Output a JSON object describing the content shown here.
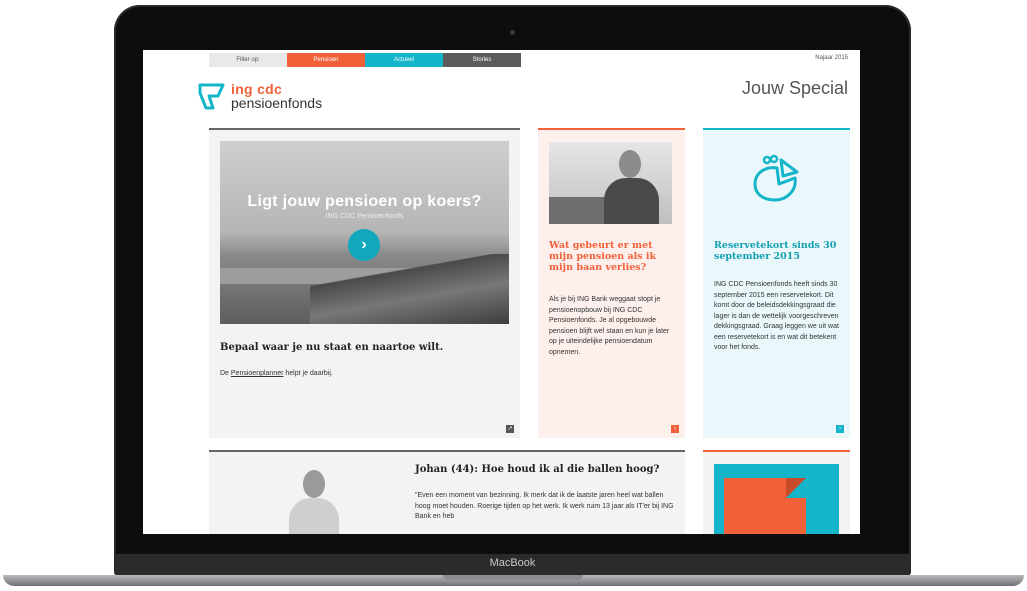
{
  "device": {
    "label": "MacBook"
  },
  "filter": {
    "label": "Filter op:",
    "tabs": [
      "Pensioen",
      "Actueel",
      "Stories"
    ],
    "edition": "Najaar 2015"
  },
  "brand": {
    "line1": "ing cdc",
    "line2": "pensioenfonds"
  },
  "header": {
    "title": "Jouw Special"
  },
  "main_card": {
    "hero_title": "Ligt jouw pensioen op koers?",
    "hero_subtitle": "ING CDC Pensioenfonds",
    "heading": "Bepaal waar je nu staat en naartoe wilt.",
    "text_prefix": "De ",
    "text_link": "Pensioenplanner",
    "text_suffix": " helpt je daarbij."
  },
  "orange_card": {
    "title": "Wat gebeurt er met mijn pensioen als ik mijn baan verlies?",
    "text": "Als je bij ING Bank weggaat stopt je pensioenopbouw bij ING CDC Pensioenfonds. Je al opgebouwde pensioen blijft wel staan en kun je later op je uiteindelijke pensioendatum opnemen."
  },
  "blue_card": {
    "title": "Reservetekort sinds 30 september 2015",
    "text": "ING CDC Pensioenfonds heeft sinds 30 september 2015 een reservetekort. Dit komt door de beleidsdekkingsgraad die lager is dan de wettelijk voorgeschreven dekkingsgraad. Graag leggen we uit wat een reservetekort is en wat dit betekent voor het fonds."
  },
  "johan_card": {
    "title": "Johan (44): Hoe houd ik al die ballen hoog?",
    "text": "\"Even een moment van bezinning. Ik merk dat ik de laatste jaren heel wat ballen hoog moet houden. Roerige tijden op het werk. Ik werk ruim 13 jaar als IT'er bij ING Bank en heb"
  },
  "colors": {
    "orange": "#f0613a",
    "blue": "#14b5c9",
    "dark": "#5c5c5c"
  },
  "icons": {
    "hero_button": "chevron-right-icon",
    "card_corner": "arrow-right-icon",
    "main_corner": "external-link-icon",
    "blue_card": "piggy-pie-icon"
  }
}
